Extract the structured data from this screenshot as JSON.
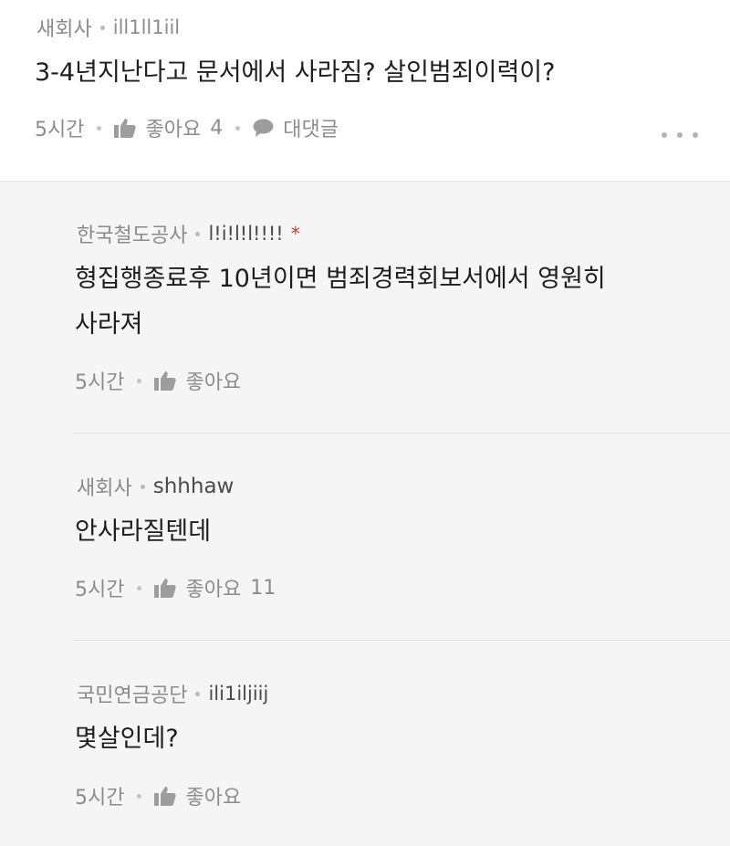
{
  "top_comment": {
    "author": "새회사",
    "nickname": "ill1ll1iil",
    "text": "3-4년지난다고 문서에서 사라짐?  살인범죄이력이?",
    "time": "5시간",
    "like_label": "좋아요",
    "like_count": "4",
    "reply_label": "대댓글",
    "icons": [
      "thumbs-up-icon",
      "speech-bubble-icon",
      "more-icon"
    ]
  },
  "replies": [
    {
      "author": "한국철도공사",
      "nickname": "l!i!l!l!!!!",
      "badge": "*",
      "text_lines": [
        "형집행종료후 10년이면 범죄경력회보서에서 영원히",
        "사라져"
      ],
      "time": "5시간",
      "like_label": "좋아요",
      "like_count": ""
    },
    {
      "author": "새회사",
      "nickname": "shhhaw",
      "text_lines": [
        "안사라질텐데"
      ],
      "time": "5시간",
      "like_label": "좋아요",
      "like_count": "11"
    },
    {
      "author": "국민연금공단",
      "nickname": "ili1iljiij",
      "text_lines": [
        "몇살인데?"
      ],
      "time": "5시간",
      "like_label": "좋아요",
      "like_count": ""
    }
  ]
}
